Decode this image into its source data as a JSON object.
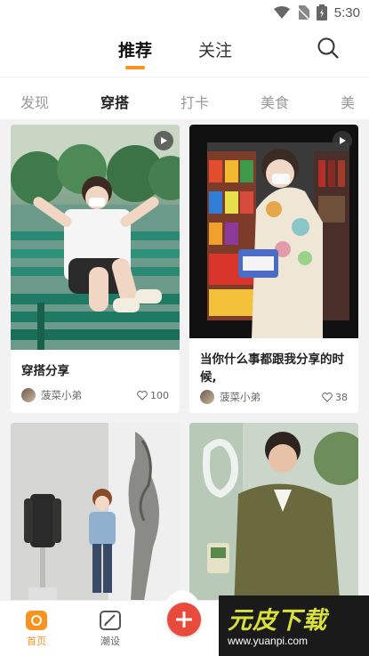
{
  "status_bar": {
    "time": "5:30"
  },
  "top_nav": {
    "tabs": [
      {
        "label": "推荐"
      },
      {
        "label": "关注"
      }
    ]
  },
  "sub_nav": {
    "items": [
      {
        "label": "发现"
      },
      {
        "label": "穿搭"
      },
      {
        "label": "打卡"
      },
      {
        "label": "美食"
      },
      {
        "label": "美"
      }
    ]
  },
  "feed": {
    "cards": [
      {
        "title": "穿搭分享",
        "user": "菠菜小弟",
        "likes": "100"
      },
      {
        "title": "当你什么事都跟我分享的时候,",
        "user": "菠菜小弟",
        "likes": "38"
      }
    ]
  },
  "bottom_nav": {
    "tabs": [
      {
        "label": "首页"
      },
      {
        "label": "潮设"
      }
    ]
  },
  "watermark": {
    "title": "元皮下载",
    "url": "www.yuanpi.com"
  },
  "colors": {
    "accent": "#f7931e",
    "plus_button": "#e84a3b"
  }
}
